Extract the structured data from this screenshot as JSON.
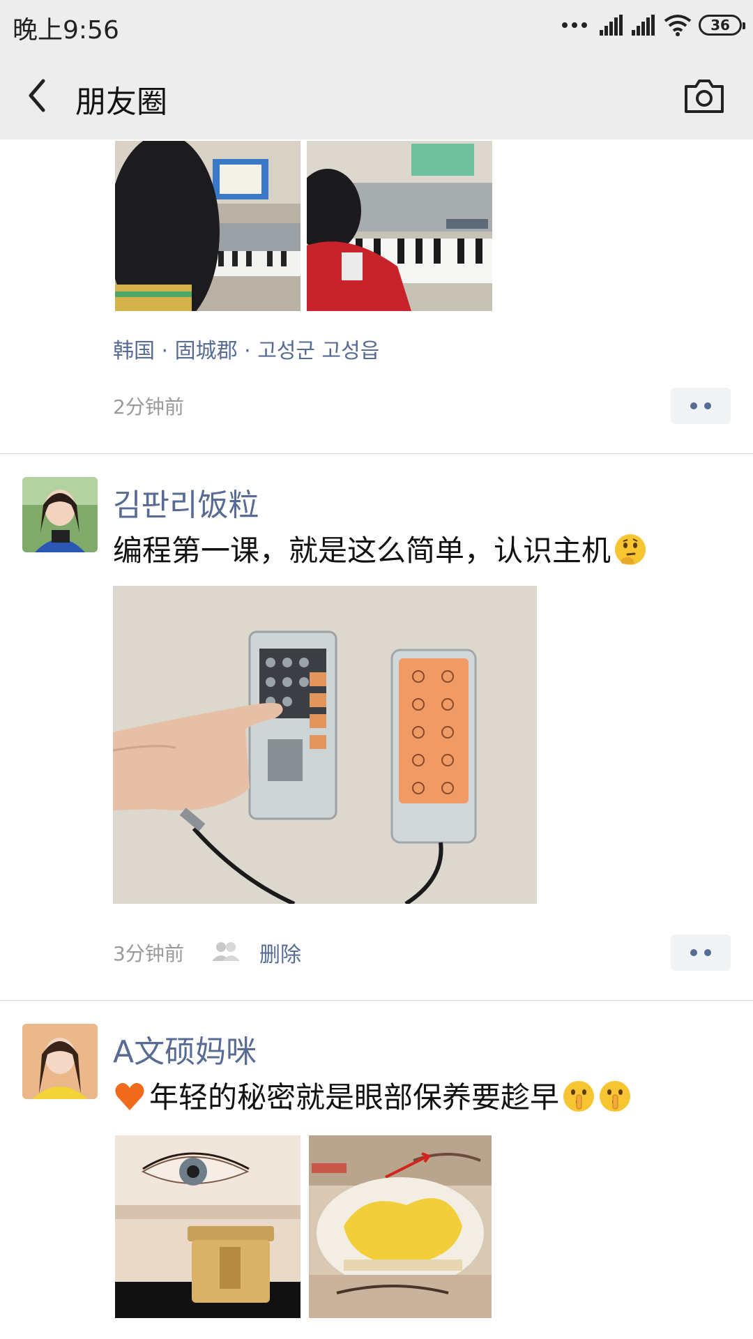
{
  "status_bar": {
    "time": "晚上9:56",
    "icons": [
      "more-dots-icon",
      "signal-1-icon",
      "signal-2-icon",
      "wifi-icon",
      "battery-icon"
    ],
    "battery_level": "36"
  },
  "nav_bar": {
    "back_icon": "chevron-left-icon",
    "title": "朋友圈",
    "camera_icon": "camera-icon"
  },
  "posts": [
    {
      "location": "韩国 · 固城郡 · 고성군 고성읍",
      "time": "2分钟前",
      "photos": [
        "boy-playing-piano-photo-1",
        "boy-playing-piano-photo-2"
      ]
    },
    {
      "author": "김판리饭粒",
      "text": "编程第一课，就是这么简单，认识主机",
      "text_emoji": "thinking-face-emoji",
      "photo": "programmable-mainboard-modules-photo",
      "time": "3分钟前",
      "delete_label": "删除",
      "privacy_icon": "friends-visibility-icon"
    },
    {
      "author": "A文硕妈咪",
      "text": "年轻的秘密就是眼部保养要趁早",
      "lead_emoji": "orange-heart-emoji",
      "trail_emojis": [
        "shushing-face-emoji",
        "shushing-face-emoji"
      ],
      "photos": [
        "eye-cream-product-photo",
        "eye-cream-texture-photo"
      ]
    }
  ],
  "colors": {
    "link_blue": "#576b95",
    "bar_gray": "#ededed",
    "timestamp_gray": "#9a9a9a"
  }
}
